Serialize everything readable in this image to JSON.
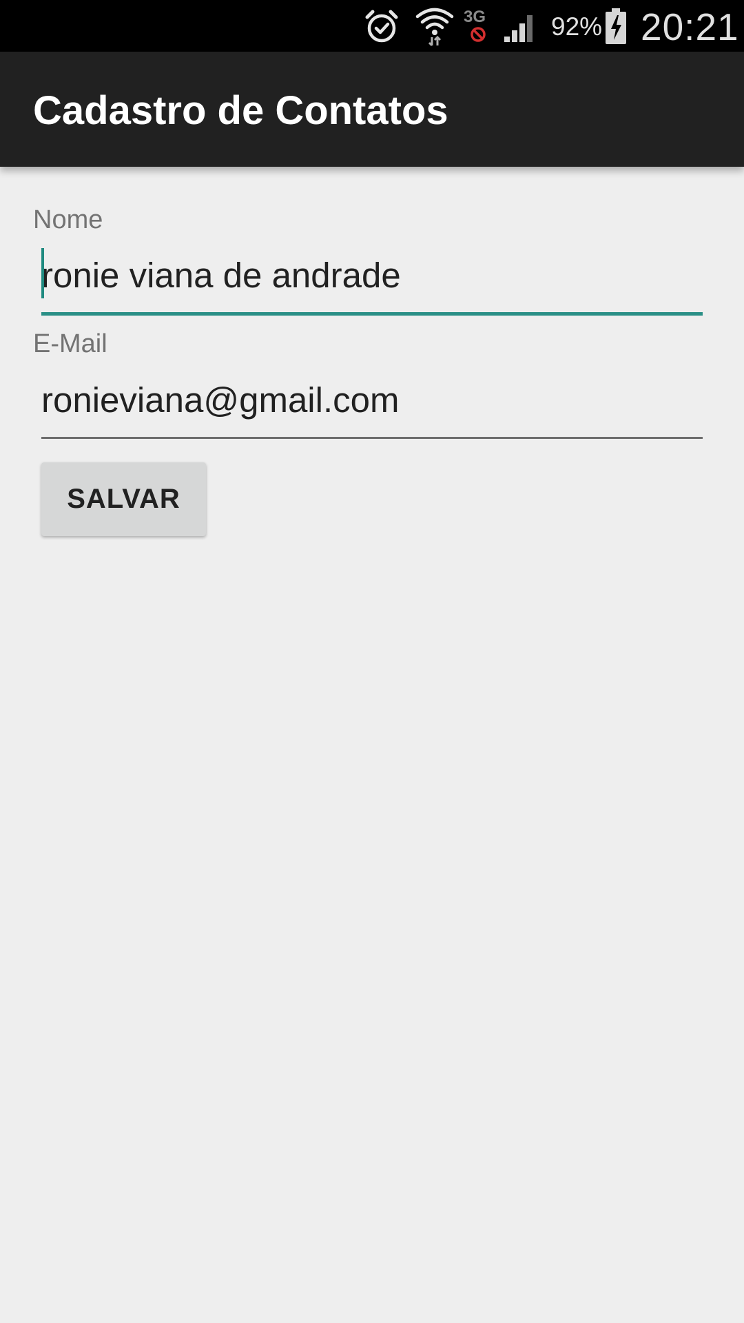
{
  "status_bar": {
    "battery_percent": "92%",
    "time": "20:21",
    "network_type": "3G",
    "icons": [
      "alarm-icon",
      "wifi-icon",
      "mobile-data-blocked-icon",
      "signal-icon",
      "battery-charging-icon"
    ],
    "colors": {
      "background": "#000000",
      "text": "#e0e0e0",
      "blocked": "#d32f2f"
    }
  },
  "app_bar": {
    "title": "Cadastro de Contatos",
    "colors": {
      "background": "#212121",
      "text": "#ffffff"
    }
  },
  "form": {
    "name": {
      "label": "Nome",
      "value": "ronie viana de andrade"
    },
    "email": {
      "label": "E-Mail",
      "value": "ronieviana@gmail.com"
    },
    "save_button": {
      "label": "SALVAR"
    },
    "colors": {
      "accent": "#2a8f86",
      "background": "#eeeeee",
      "button": "#d6d7d7"
    }
  }
}
